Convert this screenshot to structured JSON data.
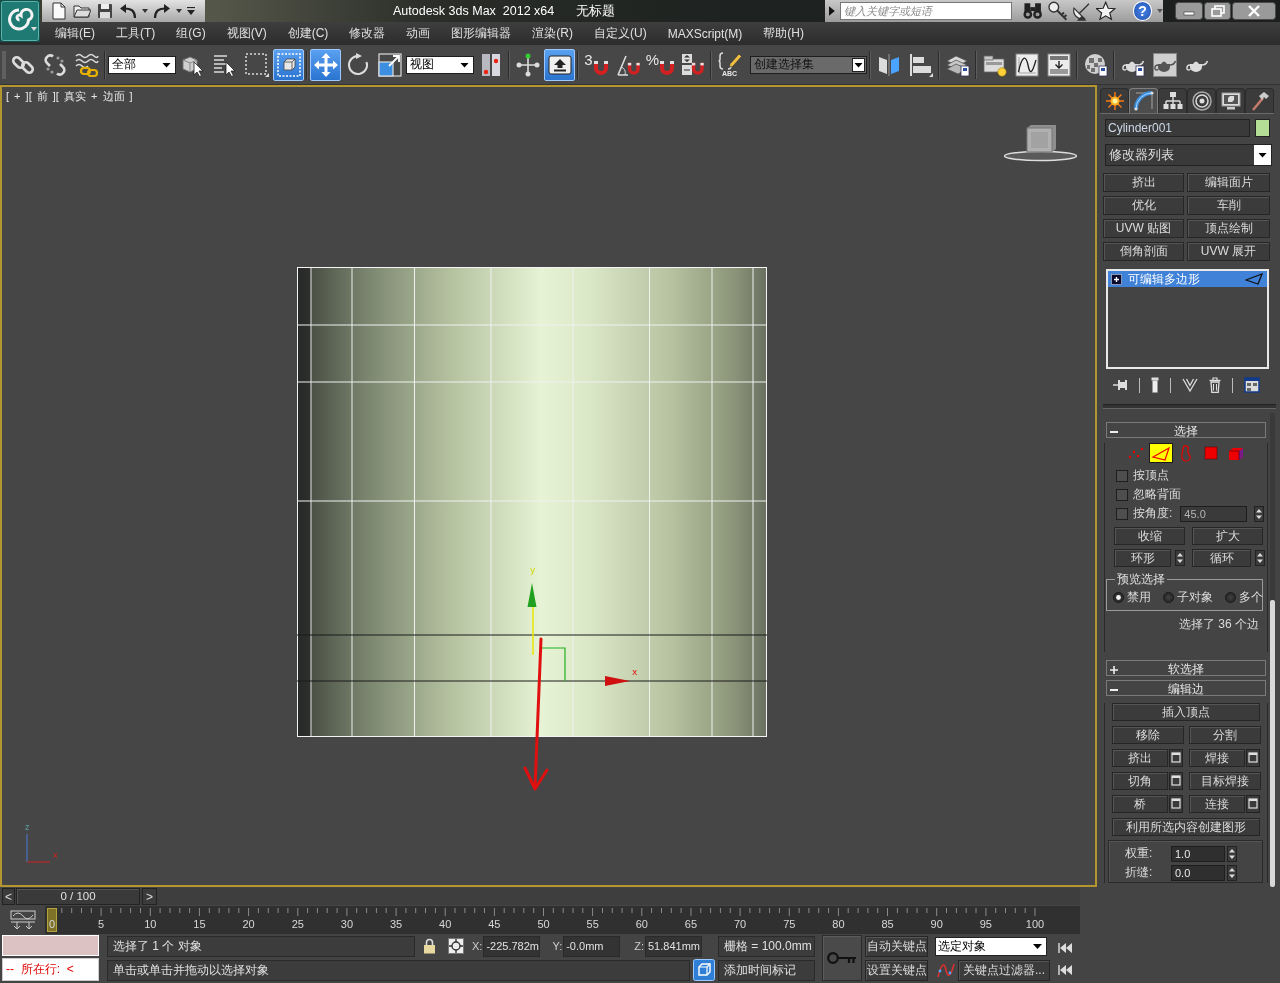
{
  "title_bar": {
    "app_title": "Autodesk 3ds Max  2012 x64",
    "document_title": "无标题",
    "search": {
      "placeholder": "键入关键字或短语"
    },
    "help": "?"
  },
  "menu_bar": [
    "编辑(E)",
    "工具(T)",
    "组(G)",
    "视图(V)",
    "创建(C)",
    "修改器",
    "动画",
    "图形编辑器",
    "渲染(R)",
    "自定义(U)",
    "MAXScript(M)",
    "帮助(H)"
  ],
  "toolbar": [
    {
      "kind": "button",
      "active": false
    },
    {
      "kind": "button",
      "active": false
    },
    {
      "kind": "button",
      "active": false
    },
    {
      "kind": "separator"
    },
    {
      "kind": "dropdown",
      "value": "全部"
    },
    {
      "kind": "button",
      "active": false
    },
    {
      "kind": "button",
      "active": false
    },
    {
      "kind": "button",
      "active": false
    },
    {
      "kind": "button",
      "active": true
    },
    {
      "kind": "separator"
    },
    {
      "kind": "button",
      "active": true
    },
    {
      "kind": "button",
      "active": false
    },
    {
      "kind": "button",
      "active": false
    },
    {
      "kind": "dropdown",
      "value": "视图"
    },
    {
      "kind": "button",
      "active": false
    },
    {
      "kind": "separator"
    },
    {
      "kind": "button",
      "active": false
    },
    {
      "kind": "button",
      "active": true
    },
    {
      "kind": "separator"
    },
    {
      "kind": "button",
      "active": false,
      "label": "3"
    },
    {
      "kind": "button",
      "active": false
    },
    {
      "kind": "button",
      "active": false,
      "label": "%"
    },
    {
      "kind": "button",
      "active": false
    },
    {
      "kind": "separator"
    },
    {
      "kind": "button",
      "active": false,
      "label": "ABC"
    },
    {
      "kind": "combo",
      "placeholder": "创建选择集"
    },
    {
      "kind": "separator"
    },
    {
      "kind": "button",
      "active": false
    },
    {
      "kind": "button",
      "active": false
    },
    {
      "kind": "separator"
    },
    {
      "kind": "button",
      "active": false
    },
    {
      "kind": "separator"
    },
    {
      "kind": "button",
      "active": false
    },
    {
      "kind": "button",
      "active": false
    },
    {
      "kind": "button",
      "active": false
    },
    {
      "kind": "separator"
    },
    {
      "kind": "button",
      "active": false
    },
    {
      "kind": "separator"
    },
    {
      "kind": "button",
      "active": false
    },
    {
      "kind": "button",
      "active": false
    },
    {
      "kind": "button",
      "active": false
    }
  ],
  "viewport": {
    "label": "[ + ][ 前 ][ 真实 + 边面 ]",
    "gizmo": {
      "x_label": "x",
      "y_label": "y"
    },
    "axis_tripod": {
      "z_label": "z",
      "x_label": "x"
    }
  },
  "command_panel": {
    "tabs": [
      {
        "selected": false
      },
      {
        "selected": true
      },
      {
        "selected": false
      },
      {
        "selected": false
      },
      {
        "selected": false
      },
      {
        "selected": false
      }
    ],
    "object_name": "Cylinder001",
    "modifier_list": "修改器列表",
    "modifier_buttons": [
      "挤出",
      "编辑面片",
      "优化",
      "车削",
      "UVW 贴图",
      "顶点绘制",
      "倒角剖面",
      "UVW 展开"
    ],
    "stack": [
      {
        "label": "可编辑多边形",
        "selected": true,
        "expanded": false
      }
    ],
    "rollouts": [
      {
        "kind": "selection",
        "title": "选择",
        "expanded": true,
        "levels": [
          {
            "selected": false
          },
          {
            "selected": true
          },
          {
            "selected": false
          },
          {
            "selected": false
          },
          {
            "selected": false
          }
        ],
        "checkboxes": [
          {
            "label": "按顶点",
            "checked": false
          },
          {
            "label": "忽略背面",
            "checked": false
          },
          {
            "label": "按角度:",
            "checked": false,
            "value": "45.0",
            "field_disabled": true
          }
        ],
        "grow_shrink": [
          "收缩",
          "扩大"
        ],
        "ring_loop": [
          "环形",
          "循环"
        ],
        "preview": {
          "title": "预览选择",
          "options": [
            {
              "label": "禁用",
              "selected": true
            },
            {
              "label": "子对象",
              "selected": false
            },
            {
              "label": "多个",
              "selected": false
            }
          ]
        },
        "summary": "选择了 36 个边"
      },
      {
        "kind": "soft_selection",
        "title": "软选择",
        "expanded": false
      },
      {
        "kind": "edit_edges",
        "title": "编辑边",
        "expanded": true,
        "rows": [
          [
            {
              "label": "插入顶点",
              "settings": false
            }
          ],
          [
            {
              "label": "移除",
              "settings": false
            },
            {
              "label": "分割",
              "settings": false
            }
          ],
          [
            {
              "label": "挤出",
              "settings": true
            },
            {
              "label": "焊接",
              "settings": true
            }
          ],
          [
            {
              "label": "切角",
              "settings": true
            },
            {
              "label": "目标焊接",
              "settings": false
            }
          ],
          [
            {
              "label": "桥",
              "settings": true
            },
            {
              "label": "连接",
              "settings": true
            }
          ],
          [
            {
              "label": "利用所选内容创建图形",
              "settings": false
            }
          ]
        ],
        "fields": [
          {
            "label": "权重:",
            "value": "1.0"
          },
          {
            "label": "折缝:",
            "value": "0.0"
          }
        ]
      }
    ]
  },
  "time_slider": {
    "previous": "<",
    "position": "0 / 100",
    "next": ">",
    "level": 0
  },
  "track_bar": {
    "ticks": [
      "0",
      "5",
      "10",
      "15",
      "20",
      "25",
      "30",
      "35",
      "40",
      "45",
      "50",
      "55",
      "60",
      "65",
      "70",
      "75",
      "80",
      "85",
      "90",
      "95",
      "100"
    ]
  },
  "status_bar": {
    "listener_output": "--  所在行:  <",
    "selection_info": "选择了 1 个 对象",
    "coordinates": [
      {
        "axis": "X:",
        "value": "-225.782m"
      },
      {
        "axis": "Y:",
        "value": "-0.0mm"
      },
      {
        "axis": "Z:",
        "value": "51.841mm"
      }
    ],
    "grid": "栅格 = 100.0mm",
    "prompt": "单击或单击并拖动以选择对象",
    "time_tag": "添加时间标记",
    "auto_key": "自动关键点",
    "key_mode": "选定对象",
    "set_key": "设置关键点",
    "key_filters": "关键点过滤器..."
  }
}
